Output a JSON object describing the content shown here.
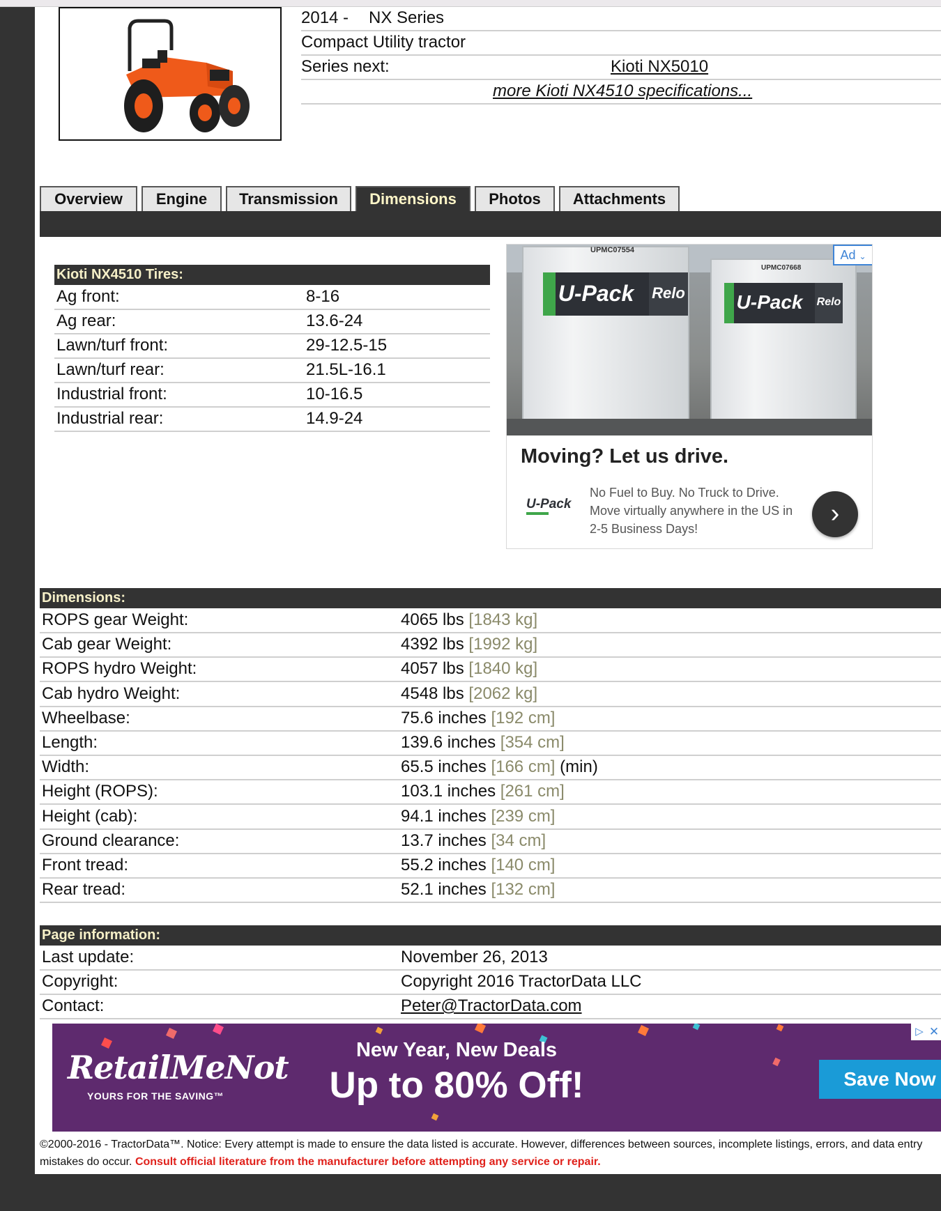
{
  "header": {
    "year_label": "2014 -",
    "series_label": "NX Series",
    "type_label": "Compact Utility tractor",
    "series_next_label": "Series next:",
    "series_next_link": "Kioti NX5010",
    "more_specs_link": "more Kioti NX4510 specifications..."
  },
  "tabs": [
    {
      "label": "Overview"
    },
    {
      "label": "Engine"
    },
    {
      "label": "Transmission"
    },
    {
      "label": "Dimensions",
      "active": true
    },
    {
      "label": "Photos"
    },
    {
      "label": "Attachments"
    }
  ],
  "tires": {
    "title": "Kioti NX4510 Tires:",
    "rows": [
      {
        "label": "Ag front:",
        "value": "8-16"
      },
      {
        "label": "Ag rear:",
        "value": "13.6-24"
      },
      {
        "label": "Lawn/turf front:",
        "value": "29-12.5-15"
      },
      {
        "label": "Lawn/turf rear:",
        "value": "21.5L-16.1"
      },
      {
        "label": "Industrial front:",
        "value": "10-16.5"
      },
      {
        "label": "Industrial rear:",
        "value": "14.9-24"
      }
    ]
  },
  "ad_upack": {
    "badge": "Ad",
    "container_code_1": "UPMC07554",
    "container_code_2": "UPMC07668",
    "brand_on_box": "U-Pack",
    "relo_text": "Relo",
    "headline": "Moving? Let us drive.",
    "logo_text": "U-Pack",
    "body": "No Fuel to Buy. No Truck to Drive. Move virtually anywhere in the US in 2-5 Business Days!"
  },
  "dimensions": {
    "title": "Dimensions:",
    "rows": [
      {
        "label": "ROPS gear Weight:",
        "value": "4065 lbs",
        "metric": "[1843 kg]",
        "suffix": ""
      },
      {
        "label": "Cab gear Weight:",
        "value": "4392 lbs",
        "metric": "[1992 kg]",
        "suffix": ""
      },
      {
        "label": "ROPS hydro Weight:",
        "value": "4057 lbs",
        "metric": "[1840 kg]",
        "suffix": ""
      },
      {
        "label": "Cab hydro Weight:",
        "value": "4548 lbs",
        "metric": "[2062 kg]",
        "suffix": ""
      },
      {
        "label": "Wheelbase:",
        "value": "75.6 inches",
        "metric": "[192 cm]",
        "suffix": ""
      },
      {
        "label": "Length:",
        "value": "139.6 inches",
        "metric": "[354 cm]",
        "suffix": ""
      },
      {
        "label": "Width:",
        "value": "65.5 inches",
        "metric": "[166 cm]",
        "suffix": "(min)"
      },
      {
        "label": "Height (ROPS):",
        "value": "103.1 inches",
        "metric": "[261 cm]",
        "suffix": ""
      },
      {
        "label": "Height (cab):",
        "value": "94.1 inches",
        "metric": "[239 cm]",
        "suffix": ""
      },
      {
        "label": "Ground clearance:",
        "value": "13.7 inches",
        "metric": "[34 cm]",
        "suffix": ""
      },
      {
        "label": "Front tread:",
        "value": "55.2 inches",
        "metric": "[140 cm]",
        "suffix": ""
      },
      {
        "label": "Rear tread:",
        "value": "52.1 inches",
        "metric": "[132 cm]",
        "suffix": ""
      }
    ]
  },
  "page_info": {
    "title": "Page information:",
    "last_update_label": "Last update:",
    "last_update_value": "November 26, 2013",
    "copyright_label": "Copyright:",
    "copyright_value": "Copyright 2016 TractorData LLC",
    "contact_label": "Contact:",
    "contact_value": "Peter@TractorData.com"
  },
  "ad_retailmenot": {
    "brand": "RetailMeNot",
    "tagline": "YOURS FOR THE SAVING™",
    "headline_small": "New Year, New Deals",
    "headline_big": "Up to 80% Off!",
    "cta": "Save Now"
  },
  "footer": {
    "notice": "©2000-2016 - TractorData™. Notice: Every attempt is made to ensure the data listed is accurate. However, differences between sources, incomplete listings, errors, and data entry mistakes do occur.",
    "warning": "Consult official literature from the manufacturer before attempting any service or repair."
  },
  "colors": {
    "page_bg": "#333333",
    "section_header_bg": "#333333",
    "section_header_text": "#f6f0c8",
    "metric_text": "#8a8a6a",
    "warning_text": "#e0211b",
    "ad_purple": "#5e2a6e",
    "ad_cta_blue": "#1a9bd7"
  }
}
